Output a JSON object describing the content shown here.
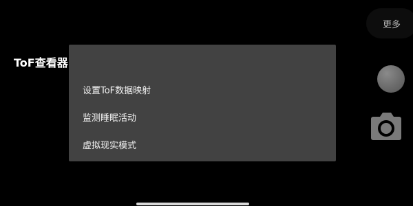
{
  "top_right": {
    "more_label": "更多"
  },
  "dialog": {
    "title": "ToF查看器",
    "items": [
      {
        "label": "设置ToF数据映射"
      },
      {
        "label": "监测睡眠活动"
      },
      {
        "label": "虚拟现实模式"
      }
    ]
  },
  "icons": {
    "capture": "round-capture-icon",
    "camera": "camera-icon"
  },
  "colors": {
    "background": "#000000",
    "dialog_bg": "#424242",
    "text": "#ffffff"
  }
}
